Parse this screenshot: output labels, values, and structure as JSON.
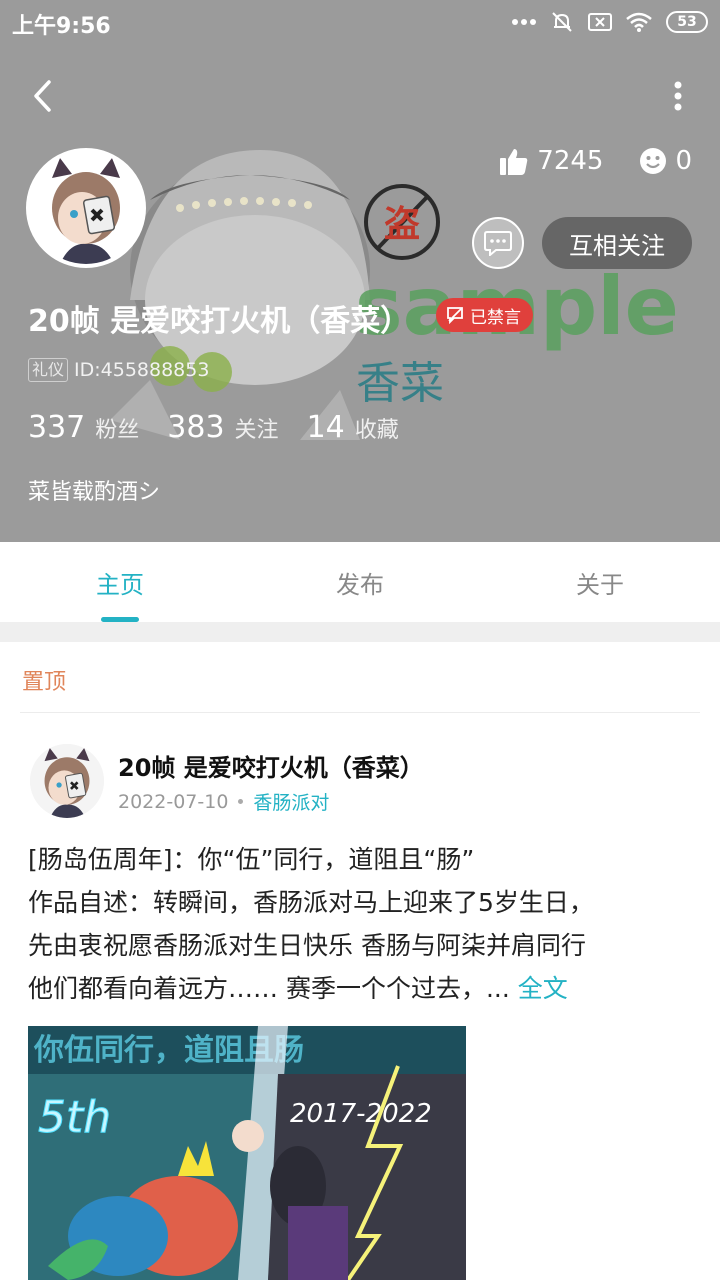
{
  "status_bar": {
    "time": "上午9:56",
    "battery": "53",
    "icons": [
      "dots-icon",
      "bell-muted-icon",
      "sim-off-icon",
      "wifi-icon",
      "battery-icon"
    ]
  },
  "header": {
    "stats": {
      "likes": "7245",
      "smiles": "0"
    },
    "follow_button": "互相关注",
    "user_name": "20帧 是爱咬打火机（香菜）",
    "banned_badge": "已禁言",
    "id_tag": "礼仪",
    "id_text": "ID:455888853",
    "fans": {
      "count": "337",
      "label": "粉丝"
    },
    "following": {
      "count": "383",
      "label": "关注"
    },
    "favorites": {
      "count": "14",
      "label": "收藏"
    },
    "signature": "菜皆载酌酒シ",
    "banner_text": {
      "stamp": "盗",
      "watermark": "sample",
      "sub": "香菜"
    }
  },
  "tabs": [
    {
      "label": "主页",
      "active": true
    },
    {
      "label": "发布",
      "active": false
    },
    {
      "label": "关于",
      "active": false
    }
  ],
  "feed": {
    "pinned_label": "置顶",
    "post": {
      "author": "20帧 是爱咬打火机（香菜）",
      "date": "2022-07-10",
      "topic": "香肠派对",
      "lines": [
        "[肠岛伍周年]：你“伍”同行，道阻且“肠”",
        " 作品自述：转瞬间，香肠派对马上迎来了5岁生日，",
        "先由衷祝愿香肠派对生日快乐 香肠与阿柒并肩同行",
        " 他们都看向着远方…… 赛季一个个过去，... "
      ],
      "read_more": "全文",
      "image_text": {
        "top": "你伍同行，道阻且肠",
        "left": "5th",
        "right": "2017-2022"
      }
    }
  },
  "colors": {
    "accent": "#23b2c4",
    "banned": "#e0403c",
    "pinned": "#e0855a",
    "header_bg": "#9b9b9b"
  }
}
